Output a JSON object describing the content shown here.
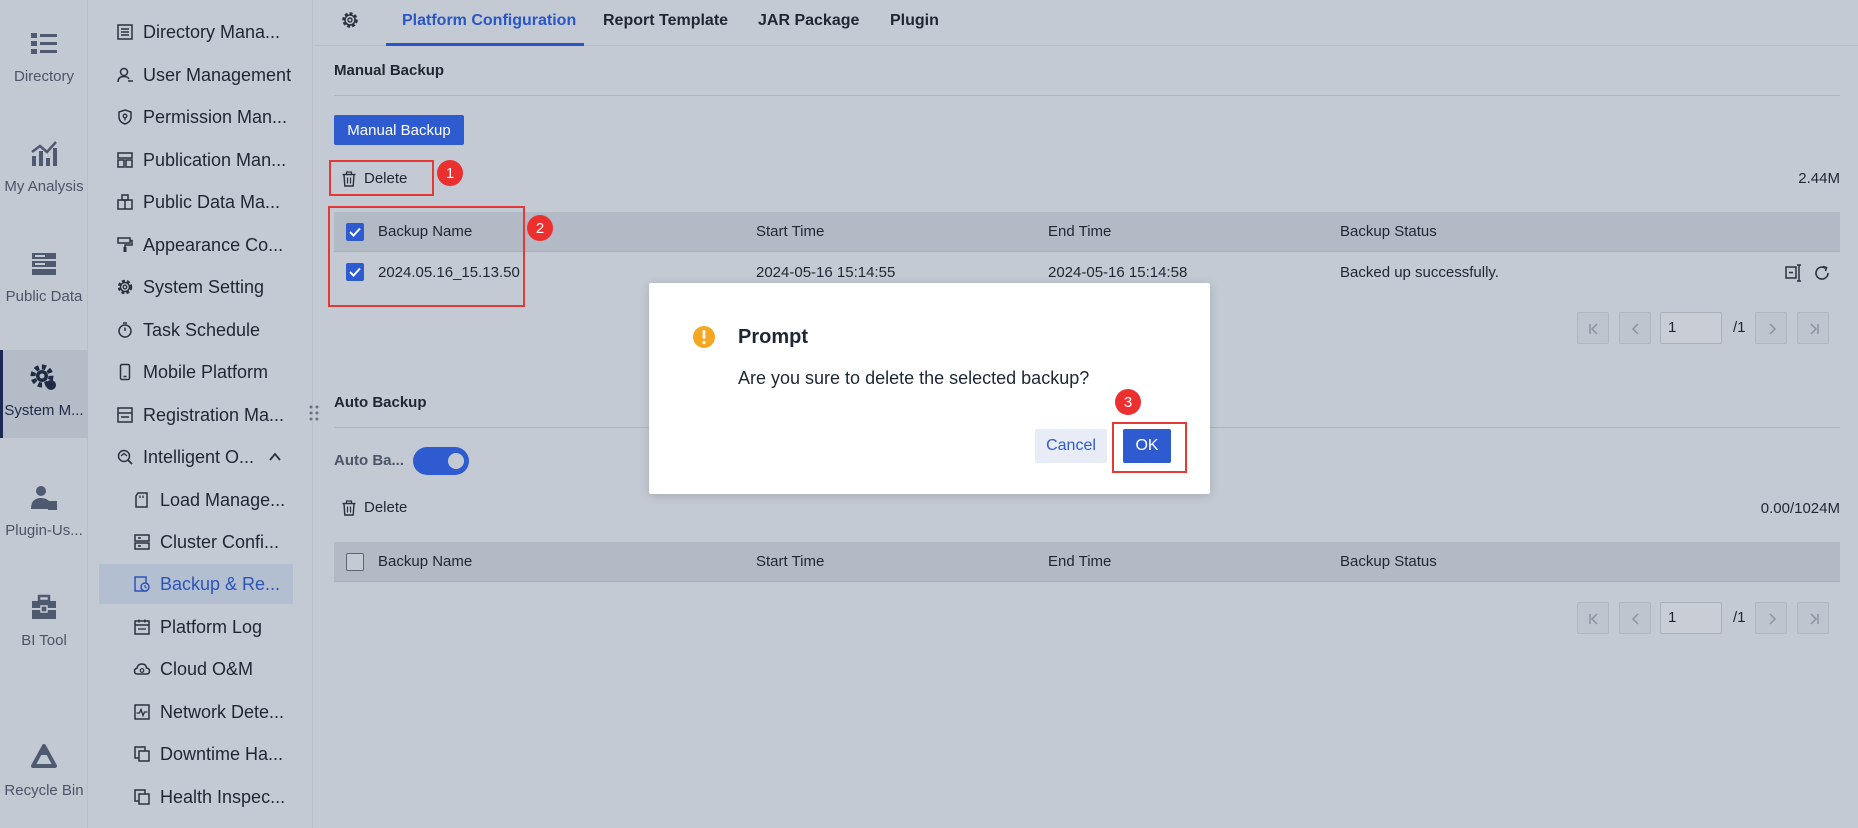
{
  "rail": {
    "items": [
      {
        "label": "Directory"
      },
      {
        "label": "My Analysis"
      },
      {
        "label": "Public Data"
      },
      {
        "label": "System M..."
      },
      {
        "label": "Plugin-Us..."
      },
      {
        "label": "BI Tool"
      },
      {
        "label": "Recycle Bin"
      }
    ]
  },
  "nav": {
    "items": [
      {
        "label": "Directory Mana..."
      },
      {
        "label": "User Management"
      },
      {
        "label": "Permission Man..."
      },
      {
        "label": "Publication Man..."
      },
      {
        "label": "Public Data Ma..."
      },
      {
        "label": "Appearance Co..."
      },
      {
        "label": "System Setting"
      },
      {
        "label": "Task Schedule"
      },
      {
        "label": "Mobile Platform"
      },
      {
        "label": "Registration Ma..."
      },
      {
        "label": "Intelligent O..."
      }
    ],
    "sub_items": [
      {
        "label": "Load Manage..."
      },
      {
        "label": "Cluster Confi..."
      },
      {
        "label": "Backup & Re..."
      },
      {
        "label": "Platform Log"
      },
      {
        "label": "Cloud O&M"
      },
      {
        "label": "Network Dete..."
      },
      {
        "label": "Downtime Ha..."
      },
      {
        "label": "Health Inspec..."
      }
    ]
  },
  "tabs": [
    {
      "label": "Platform Configuration"
    },
    {
      "label": "Report Template"
    },
    {
      "label": "JAR Package"
    },
    {
      "label": "Plugin"
    }
  ],
  "manual": {
    "title": "Manual Backup",
    "button": "Manual Backup",
    "delete": "Delete",
    "size": "2.44M",
    "columns": [
      "Backup Name",
      "Start Time",
      "End Time",
      "Backup Status"
    ],
    "rows": [
      {
        "name": "2024.05.16_15.13.50",
        "start": "2024-05-16 15:14:55",
        "end": "2024-05-16 15:14:58",
        "status": "Backed up successfully."
      }
    ],
    "page": "1",
    "total": "/1"
  },
  "auto": {
    "title": "Auto Backup",
    "toggle_label": "Auto Ba...",
    "delete": "Delete",
    "size": "0.00/1024M",
    "columns": [
      "Backup Name",
      "Start Time",
      "End Time",
      "Backup Status"
    ],
    "page": "1",
    "total": "/1"
  },
  "modal": {
    "title": "Prompt",
    "message": "Are you sure to delete the selected backup?",
    "cancel": "Cancel",
    "ok": "OK"
  },
  "annotations": [
    "1",
    "2",
    "3"
  ],
  "colors": {
    "accent": "#2f5bd0",
    "annotation": "#e53935",
    "warning": "#f5a623"
  }
}
